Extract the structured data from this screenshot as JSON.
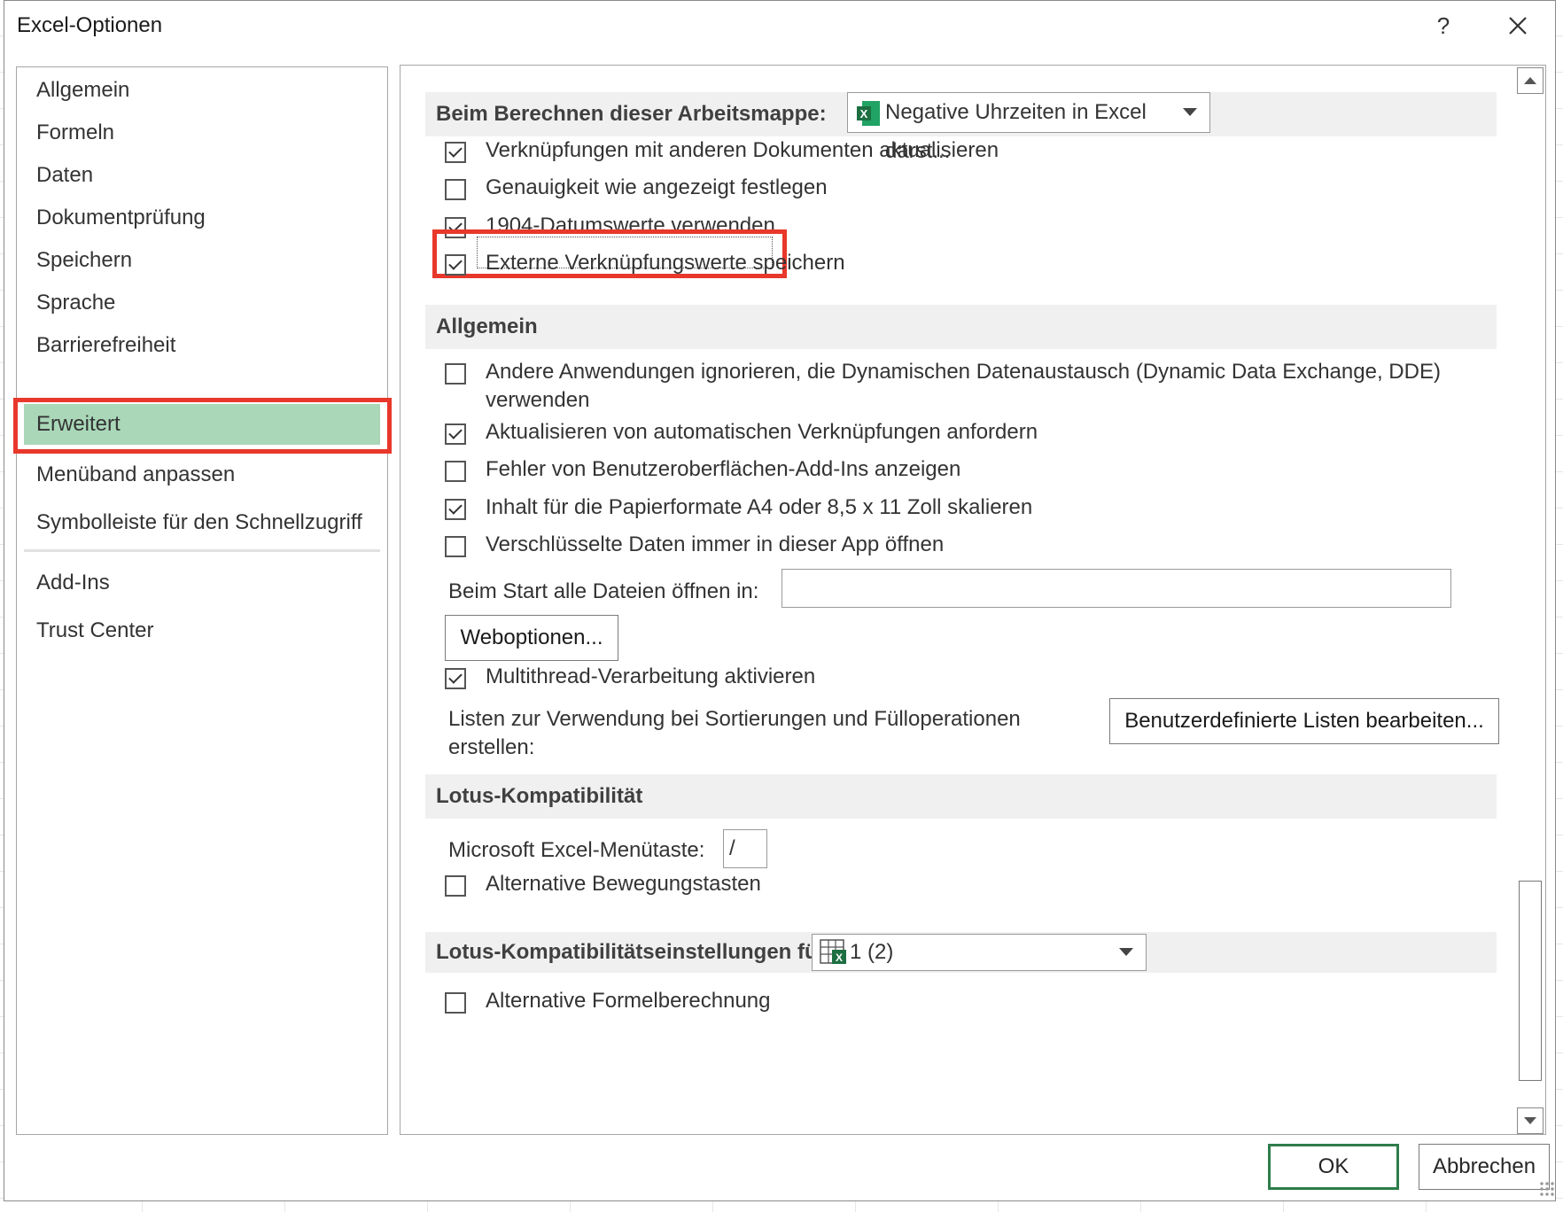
{
  "window": {
    "title": "Excel-Optionen",
    "help": "?"
  },
  "sidebar": {
    "items": [
      {
        "label": "Allgemein"
      },
      {
        "label": "Formeln"
      },
      {
        "label": "Daten"
      },
      {
        "label": "Dokumentprüfung"
      },
      {
        "label": "Speichern"
      },
      {
        "label": "Sprache"
      },
      {
        "label": "Barrierefreiheit"
      },
      {
        "label": "Erweitert",
        "selected": true
      },
      {
        "label": "Menüband anpassen"
      },
      {
        "label": "Symbolleiste für den Schnellzugriff"
      },
      {
        "label": "Add-Ins"
      },
      {
        "label": "Trust Center"
      }
    ]
  },
  "workbook_calc": {
    "label": "Beim Berechnen dieser Arbeitsmappe:",
    "workbook_selected": "Negative Uhrzeiten in Excel darst...",
    "options": [
      {
        "label": "Verknüpfungen mit anderen Dokumenten aktualisieren",
        "checked": true
      },
      {
        "label": "Genauigkeit wie angezeigt festlegen",
        "checked": false
      },
      {
        "label": "1904-Datumswerte verwenden",
        "checked": true
      },
      {
        "label": "Externe Verknüpfungswerte speichern",
        "checked": true
      }
    ]
  },
  "general": {
    "label": "Allgemein",
    "options": [
      {
        "label": "Andere Anwendungen ignorieren, die Dynamischen Datenaustausch (Dynamic Data Exchange, DDE)",
        "label2": "verwenden",
        "checked": false
      },
      {
        "label": "Aktualisieren von automatischen Verknüpfungen anfordern",
        "checked": true
      },
      {
        "label": "Fehler von Benutzeroberflächen-Add-Ins anzeigen",
        "checked": false
      },
      {
        "label": "Inhalt für die Papierformate A4 oder 8,5 x 11 Zoll skalieren",
        "checked": true
      },
      {
        "label": "Verschlüsselte Daten immer in dieser App öffnen",
        "checked": false
      }
    ],
    "startup_label": "Beim Start alle Dateien öffnen in:",
    "startup_value": "",
    "web_options_button": "Weboptionen...",
    "multithread": {
      "label": "Multithread-Verarbeitung aktivieren",
      "checked": true
    },
    "lists_label_1": "Listen zur Verwendung bei Sortierungen und Fülloperationen",
    "lists_label_2": "erstellen:",
    "edit_lists_button": "Benutzerdefinierte Listen bearbeiten..."
  },
  "lotus": {
    "label": "Lotus-Kompatibilität",
    "menu_key_label": "Microsoft Excel-Menütaste:",
    "menu_key_value": "/",
    "alt_nav": {
      "label": "Alternative Bewegungstasten",
      "checked": false
    }
  },
  "lotus_settings": {
    "label": "Lotus-Kompatibilitätseinstellungen für:",
    "sheet_selected": "1 (2)",
    "alt_formula": {
      "label": "Alternative Formelberechnung",
      "checked": false
    }
  },
  "footer": {
    "ok": "OK",
    "cancel": "Abbrechen"
  },
  "colors": {
    "selected_nav": "#a9d7b8",
    "highlight": "#e8382b",
    "ok_border": "#2e7d4a",
    "excel_green": "#1d6f42"
  }
}
